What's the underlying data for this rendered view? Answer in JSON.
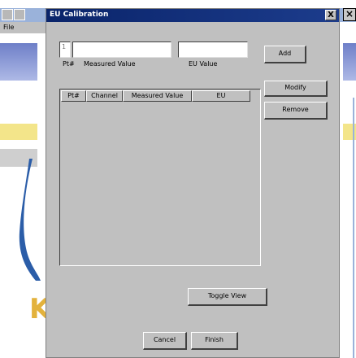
{
  "background_app": {
    "menu": {
      "file_label": "File"
    },
    "logo_letter": "K"
  },
  "dialog": {
    "title": "EU Calibration",
    "inputs": {
      "pt_value": "1",
      "measured_value": "",
      "eu_value": ""
    },
    "input_labels": {
      "pt": "Pt#",
      "measured": "Measured Value",
      "eu": "EU Value"
    },
    "table": {
      "columns": [
        "Pt#",
        "Channel",
        "Measured Value",
        "EU"
      ],
      "rows": []
    },
    "buttons": {
      "add": "Add",
      "modify": "Modify",
      "remove": "Remove",
      "toggle_view": "Toggle View",
      "cancel": "Cancel",
      "finish": "Finish",
      "close": "X"
    }
  }
}
